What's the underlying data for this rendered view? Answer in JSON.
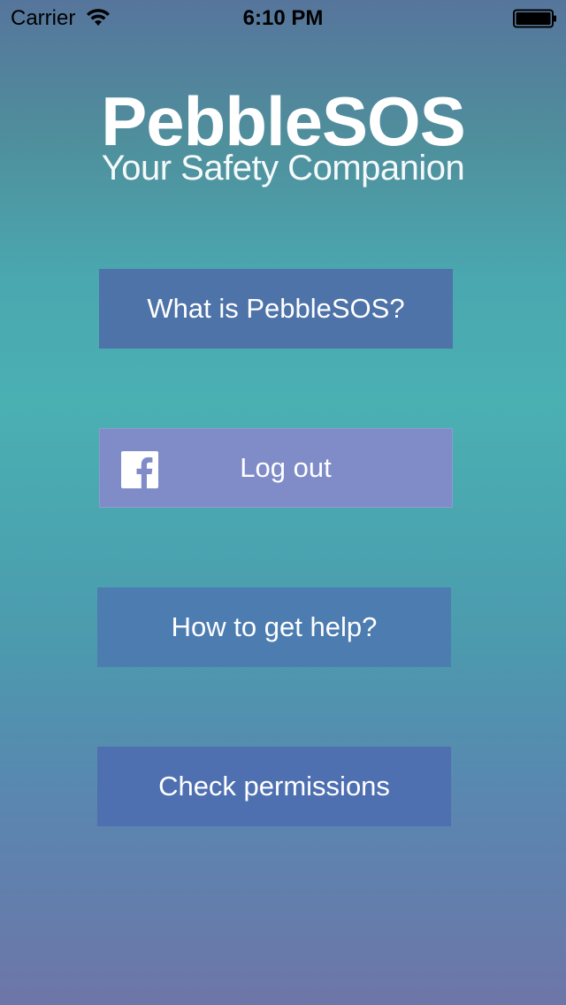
{
  "status_bar": {
    "carrier": "Carrier",
    "time": "6:10 PM",
    "icons": [
      "wifi-icon",
      "battery-icon"
    ]
  },
  "header": {
    "title": "PebbleSOS",
    "subtitle": "Your Safety Companion"
  },
  "buttons": {
    "what_is": "What is PebbleSOS?",
    "logout": "Log out",
    "get_help": "How to get help?",
    "check_permissions": "Check permissions"
  },
  "icons": {
    "facebook": "facebook-icon"
  },
  "colors": {
    "what_is_button": "#4e73a8",
    "logout_button": "#7f8cc8",
    "get_help_button": "#4d7db0",
    "check_permissions_button": "#4f70b0",
    "background_top": "#56759c",
    "background_middle": "#4ab0b2",
    "background_bottom": "#6d76a8"
  }
}
